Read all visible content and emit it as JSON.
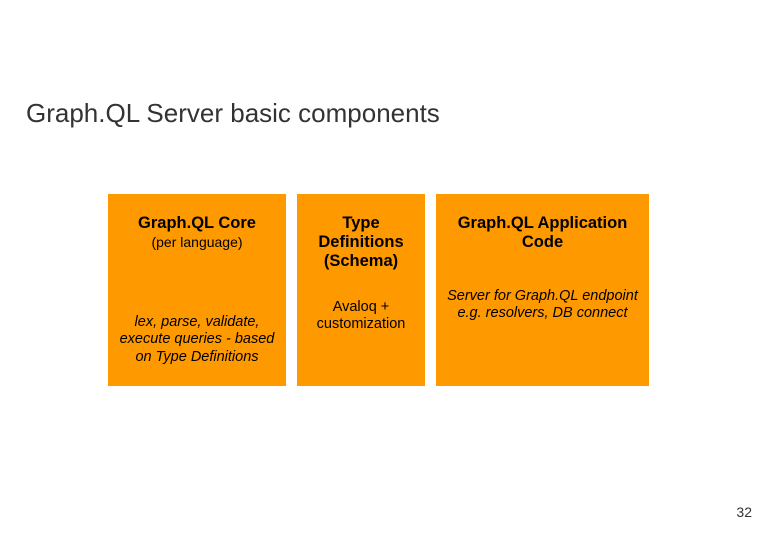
{
  "slide": {
    "title": "Graph.QL Server basic components",
    "pageNumber": "32"
  },
  "boxes": [
    {
      "title": "Graph.QL Core",
      "subtitle": "(per language)",
      "description": "lex, parse, validate, execute queries - based on Type Definitions"
    },
    {
      "title": "Type Definitions (Schema)",
      "subtitle": "",
      "description": "Avaloq + customization"
    },
    {
      "title": "Graph.QL Application Code",
      "subtitle": "",
      "description": "Server for Graph.QL endpoint e.g. resolvers, DB connect"
    }
  ],
  "colors": {
    "boxBackground": "#ff9900"
  }
}
